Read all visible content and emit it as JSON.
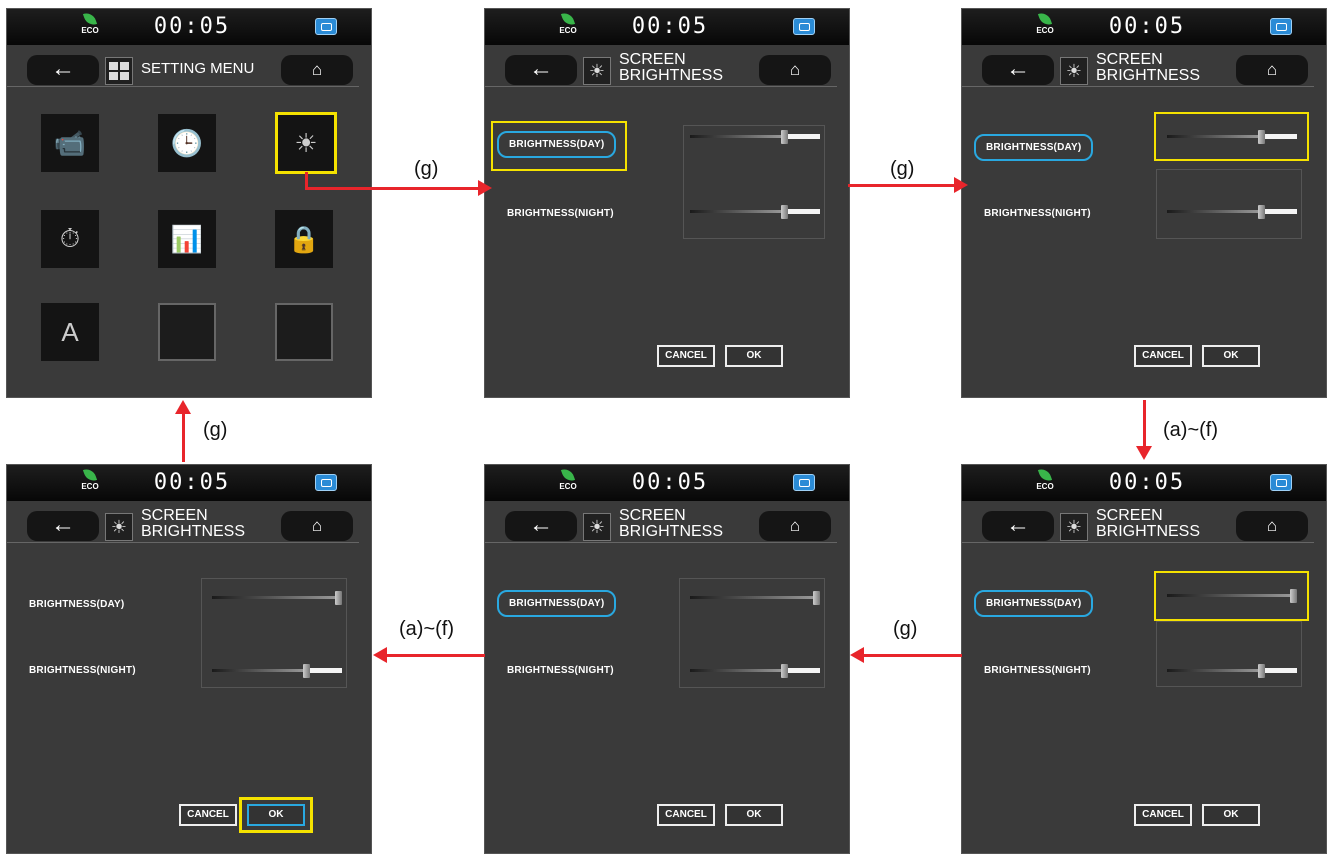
{
  "status": {
    "time": "00:05",
    "eco": "ECO"
  },
  "setting_menu": {
    "title": "SETTING MENU"
  },
  "brightness": {
    "title": "SCREEN\nBRIGHTNESS",
    "day_label": "BRIGHTNESS(DAY)",
    "night_label": "BRIGHTNESS(NIGHT)",
    "cancel": "CANCEL",
    "ok": "OK"
  },
  "arrows": {
    "g": "(g)",
    "af": "(a)~(f)"
  },
  "levels": {
    "screen2": {
      "day": 0.72,
      "night": 0.72
    },
    "screen3": {
      "day": 0.72,
      "night": 0.72
    },
    "screen4": {
      "day": 0.97,
      "night": 0.72
    },
    "screen5": {
      "day": 0.97,
      "night": 0.72
    },
    "screen6": {
      "day": 0.97,
      "night": 0.72
    }
  },
  "colors": {
    "highlight": "#f5e200",
    "selected": "#29a8e0",
    "arrow": "#e8252b"
  }
}
